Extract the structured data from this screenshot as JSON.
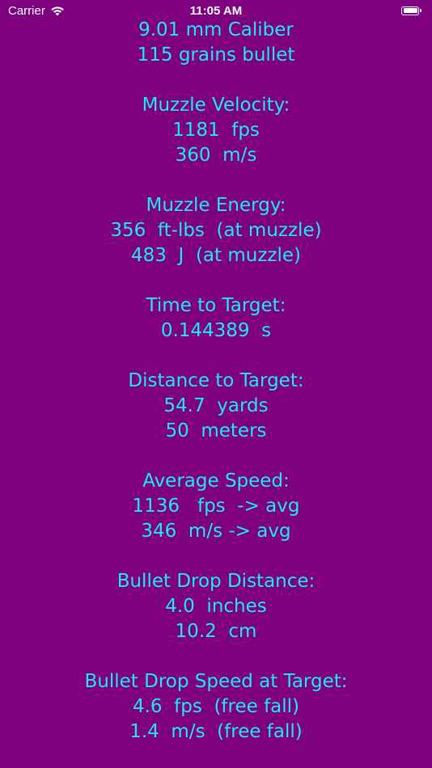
{
  "status_bar": {
    "carrier": "Carrier",
    "time": "11:05 AM"
  },
  "results": {
    "caliber": "9.01 mm Caliber",
    "bullet": "115 grains bullet",
    "muzzle_velocity": {
      "title": "Muzzle Velocity:",
      "fps": "1181  fps",
      "ms": "360  m/s"
    },
    "muzzle_energy": {
      "title": "Muzzle Energy:",
      "ftlbs": "356  ft-lbs  (at muzzle)",
      "joules": "483  J  (at muzzle)"
    },
    "time_to_target": {
      "title": "Time to Target:",
      "seconds": "0.144389  s"
    },
    "distance_to_target": {
      "title": "Distance to Target:",
      "yards": "54.7  yards",
      "meters": "50  meters"
    },
    "average_speed": {
      "title": "Average Speed:",
      "fps": "1136   fps  -> avg",
      "ms": "346  m/s -> avg"
    },
    "bullet_drop_distance": {
      "title": "Bullet Drop Distance:",
      "inches": "4.0  inches",
      "cm": "10.2  cm"
    },
    "bullet_drop_speed": {
      "title": "Bullet Drop Speed at Target:",
      "fps": "4.6  fps  (free fall)",
      "ms": "1.4  m/s  (free fall)"
    }
  },
  "colors": {
    "background": "#7f007f",
    "text": "#1de9f4"
  }
}
